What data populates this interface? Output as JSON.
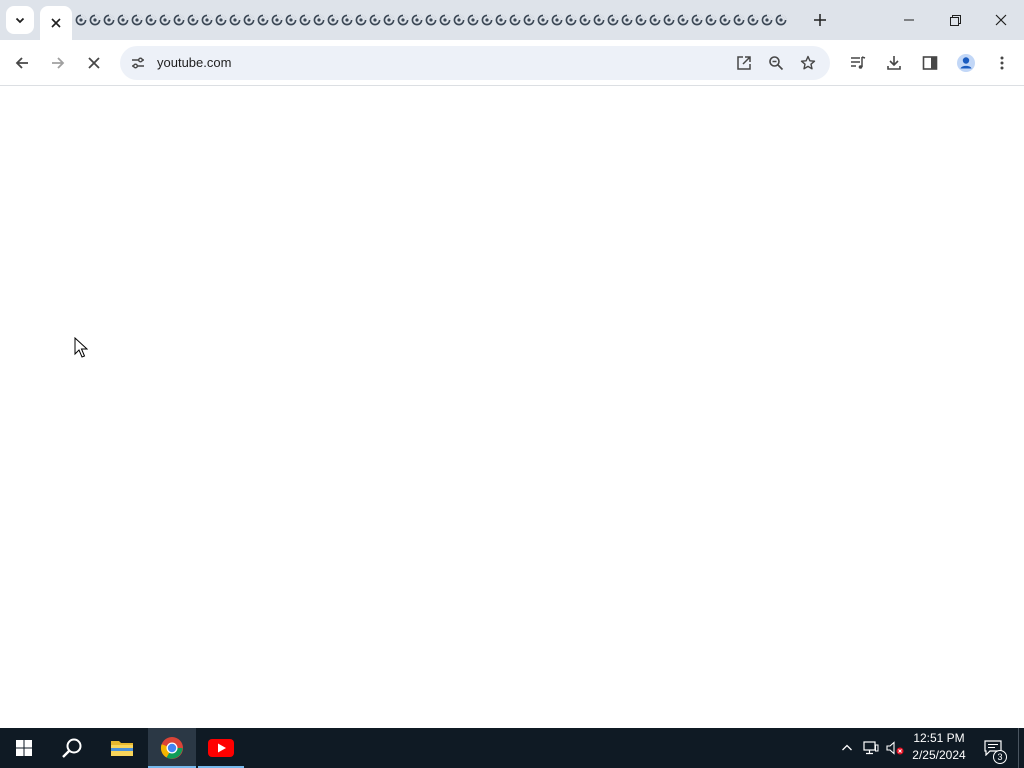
{
  "browser": {
    "tab_count_visible": 51,
    "address": "youtube.com",
    "loading": true,
    "colors": {
      "tabstrip": "#dee3ea",
      "omnibox": "#edf1f8",
      "toolbar_icon": "#474747"
    }
  },
  "taskbar": {
    "time": "12:51 PM",
    "date": "2/25/2024",
    "notification_count": "3",
    "colors": {
      "background": "#0f1a24",
      "active_item": "#2b3845",
      "youtube_red": "#ff0000"
    }
  }
}
